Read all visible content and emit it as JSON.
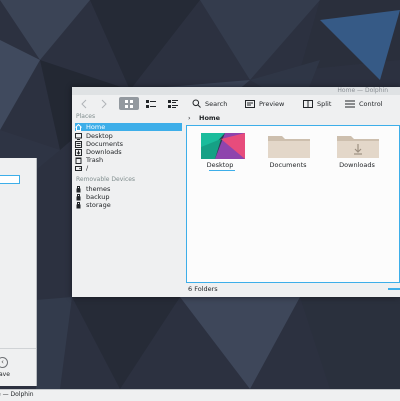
{
  "window": {
    "title": "Home — Dolphin"
  },
  "toolbar": {
    "search_label": "Search",
    "preview_label": "Preview",
    "split_label": "Split",
    "control_label": "Control"
  },
  "places": {
    "header": "Places",
    "items": [
      {
        "label": "Home",
        "icon": "home-icon",
        "selected": true
      },
      {
        "label": "Desktop",
        "icon": "desktop-icon"
      },
      {
        "label": "Documents",
        "icon": "documents-icon"
      },
      {
        "label": "Downloads",
        "icon": "downloads-icon"
      },
      {
        "label": "Trash",
        "icon": "trash-icon"
      },
      {
        "label": "/",
        "icon": "root-drive-icon"
      }
    ],
    "removable_header": "Removable Devices",
    "removable": [
      {
        "label": "themes",
        "icon": "usb-drive-icon"
      },
      {
        "label": "backup",
        "icon": "usb-drive-icon"
      },
      {
        "label": "storage",
        "icon": "usb-drive-icon"
      }
    ]
  },
  "breadcrumb": {
    "path": "Home"
  },
  "files": [
    {
      "name": "Desktop",
      "type": "wallpaper-thumbnail"
    },
    {
      "name": "Documents",
      "type": "folder"
    },
    {
      "name": "Downloads",
      "type": "folder-downloads"
    }
  ],
  "status": {
    "text": "6 Folders"
  },
  "background_window": {
    "button_label": "ave"
  },
  "taskbar": {
    "task_label": "e — Dolphin"
  },
  "colors": {
    "accent": "#3daee9",
    "window_bg": "#eff0f1",
    "view_bg": "#fcfcfc"
  }
}
